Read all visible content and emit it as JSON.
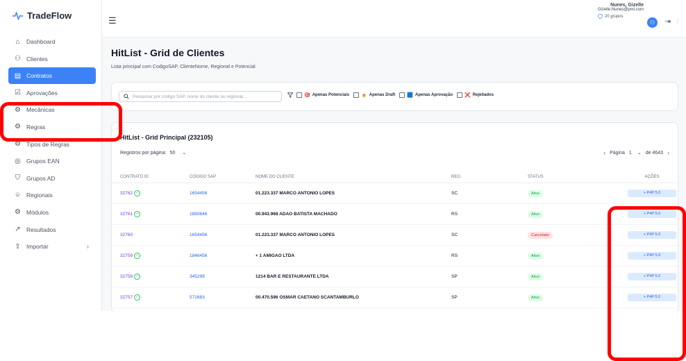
{
  "app": {
    "name": "TradeFlow"
  },
  "sidebar": {
    "items": [
      {
        "label": "Dashboard",
        "icon": "home-icon"
      },
      {
        "label": "Clientes",
        "icon": "users-icon"
      },
      {
        "label": "Contratos",
        "icon": "document-icon",
        "active": true
      },
      {
        "label": "Aprovações",
        "icon": "check-square-icon"
      },
      {
        "label": "Mecânicas",
        "icon": "gear-icon"
      },
      {
        "label": "Regras",
        "icon": "gear-icon"
      },
      {
        "label": "Tipos de Regras",
        "icon": "gear-icon"
      },
      {
        "label": "Grupos EAN",
        "icon": "target-icon"
      },
      {
        "label": "Grupos AD",
        "icon": "shield-icon"
      },
      {
        "label": "Regionais",
        "icon": "pin-icon"
      },
      {
        "label": "Módulos",
        "icon": "gear-icon"
      },
      {
        "label": "Resultados",
        "icon": "trend-icon"
      },
      {
        "label": "Importar",
        "icon": "upload-icon",
        "has_submenu": true
      }
    ]
  },
  "user": {
    "name": "Nunes, Gizelle",
    "email": "Gizelle.Nunes@pmi.com",
    "groups": "20 grupos"
  },
  "page": {
    "title": "HitList - Grid de Clientes",
    "subtitle": "Lista principal com CodigoSAP, ClienteNome, Regional e Potencial"
  },
  "filters": {
    "search_placeholder": "Pesquisar por código SAP, nome do cliente ou regional...",
    "options": [
      {
        "label": "Apenas Potenciais",
        "emoji": "🎯"
      },
      {
        "label": "Apenas Draft",
        "emoji": "🍺"
      },
      {
        "label": "Apenas Aprovação",
        "emoji": "🟦"
      },
      {
        "label": "Rejeitados",
        "emoji": "❌"
      }
    ]
  },
  "grid": {
    "title": "HitList - Grid Principal (232105)",
    "rows_per_page_label": "Registros por página:",
    "rows_per_page": "50",
    "page_label": "Página",
    "page": "1",
    "total_pages": "de 4643",
    "columns": [
      "CONTRATO ID",
      "CÓDIGO SAP",
      "NOME DO CLIENTE",
      "REG.",
      "STATUS",
      "AÇÕES"
    ],
    "rows": [
      {
        "id": "32762",
        "verified": true,
        "sap": "1654456",
        "nome": "01.223.337 MARCO ANTONIO LOPES",
        "reg": "SC",
        "status": "Ativo",
        "action": "+ P4P 5.0"
      },
      {
        "id": "32761",
        "verified": true,
        "sap": "1850646",
        "nome": "00.943.968 ADAO BATISTA MACHADO",
        "reg": "RS",
        "status": "Ativo",
        "action": "+ P4P 5.0"
      },
      {
        "id": "32760",
        "verified": false,
        "sap": "1654456",
        "nome": "01.223.337 MARCO ANTONIO LOPES",
        "reg": "SC",
        "status": "Cancelado",
        "action": "+ P4P 5.0"
      },
      {
        "id": "32759",
        "verified": true,
        "sap": "1846456",
        "nome": "+ 1 AMIGAO LTDA",
        "reg": "RS",
        "status": "Ativo",
        "action": "+ P4P 5.0"
      },
      {
        "id": "32758",
        "verified": true,
        "sap": "345299",
        "nome": "1214 BAR E RESTAURANTE LTDA",
        "reg": "SP",
        "status": "Ativo",
        "action": "+ P4P 5.0"
      },
      {
        "id": "32757",
        "verified": true,
        "sap": "571683",
        "nome": "00.470.596 OSMAR CAETANO SCANTAMBURLO",
        "reg": "SP",
        "status": "Ativo",
        "action": "+ P4P 5.0"
      }
    ]
  },
  "colors": {
    "accent": "#3b82f6",
    "annotation": "#ff0000",
    "active_badge": "#16a34a",
    "cancel_badge": "#dc2626"
  }
}
